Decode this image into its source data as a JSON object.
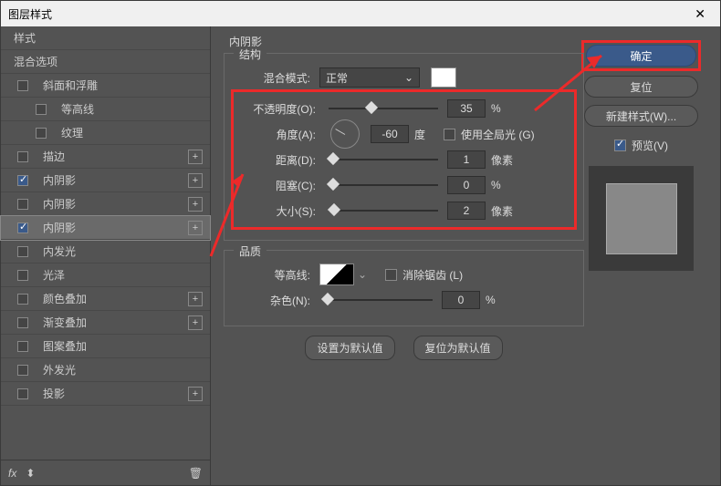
{
  "dialog": {
    "title": "图层样式"
  },
  "sidebar": {
    "header1": "样式",
    "header2": "混合选项",
    "items": [
      {
        "label": "斜面和浮雕",
        "checked": false,
        "hasPlus": false,
        "indent": false
      },
      {
        "label": "等高线",
        "checked": false,
        "hasPlus": false,
        "indent": true
      },
      {
        "label": "纹理",
        "checked": false,
        "hasPlus": false,
        "indent": true
      },
      {
        "label": "描边",
        "checked": false,
        "hasPlus": true,
        "indent": false
      },
      {
        "label": "内阴影",
        "checked": true,
        "hasPlus": true,
        "indent": false
      },
      {
        "label": "内阴影",
        "checked": false,
        "hasPlus": true,
        "indent": false
      },
      {
        "label": "内阴影",
        "checked": true,
        "hasPlus": true,
        "indent": false,
        "selected": true,
        "redbox": true
      },
      {
        "label": "内发光",
        "checked": false,
        "hasPlus": false,
        "indent": false
      },
      {
        "label": "光泽",
        "checked": false,
        "hasPlus": false,
        "indent": false
      },
      {
        "label": "颜色叠加",
        "checked": false,
        "hasPlus": true,
        "indent": false
      },
      {
        "label": "渐变叠加",
        "checked": false,
        "hasPlus": true,
        "indent": false
      },
      {
        "label": "图案叠加",
        "checked": false,
        "hasPlus": false,
        "indent": false
      },
      {
        "label": "外发光",
        "checked": false,
        "hasPlus": false,
        "indent": false
      },
      {
        "label": "投影",
        "checked": false,
        "hasPlus": true,
        "indent": false
      }
    ],
    "footer_fx": "fx"
  },
  "settings": {
    "title": "内阴影",
    "structure_label": "结构",
    "blend_mode_label": "混合模式:",
    "blend_mode_value": "正常",
    "opacity_label": "不透明度(O):",
    "opacity_value": "35",
    "opacity_unit": "%",
    "angle_label": "角度(A):",
    "angle_value": "-60",
    "angle_unit": "度",
    "global_light_label": "使用全局光 (G)",
    "distance_label": "距离(D):",
    "distance_value": "1",
    "distance_unit": "像素",
    "choke_label": "阻塞(C):",
    "choke_value": "0",
    "choke_unit": "%",
    "size_label": "大小(S):",
    "size_value": "2",
    "size_unit": "像素",
    "quality_label": "品质",
    "contour_label": "等高线:",
    "antialias_label": "消除锯齿 (L)",
    "noise_label": "杂色(N):",
    "noise_value": "0",
    "noise_unit": "%",
    "make_default": "设置为默认值",
    "reset_default": "复位为默认值"
  },
  "actions": {
    "ok": "确定",
    "cancel": "复位",
    "new_style": "新建样式(W)...",
    "preview": "预览(V)"
  }
}
